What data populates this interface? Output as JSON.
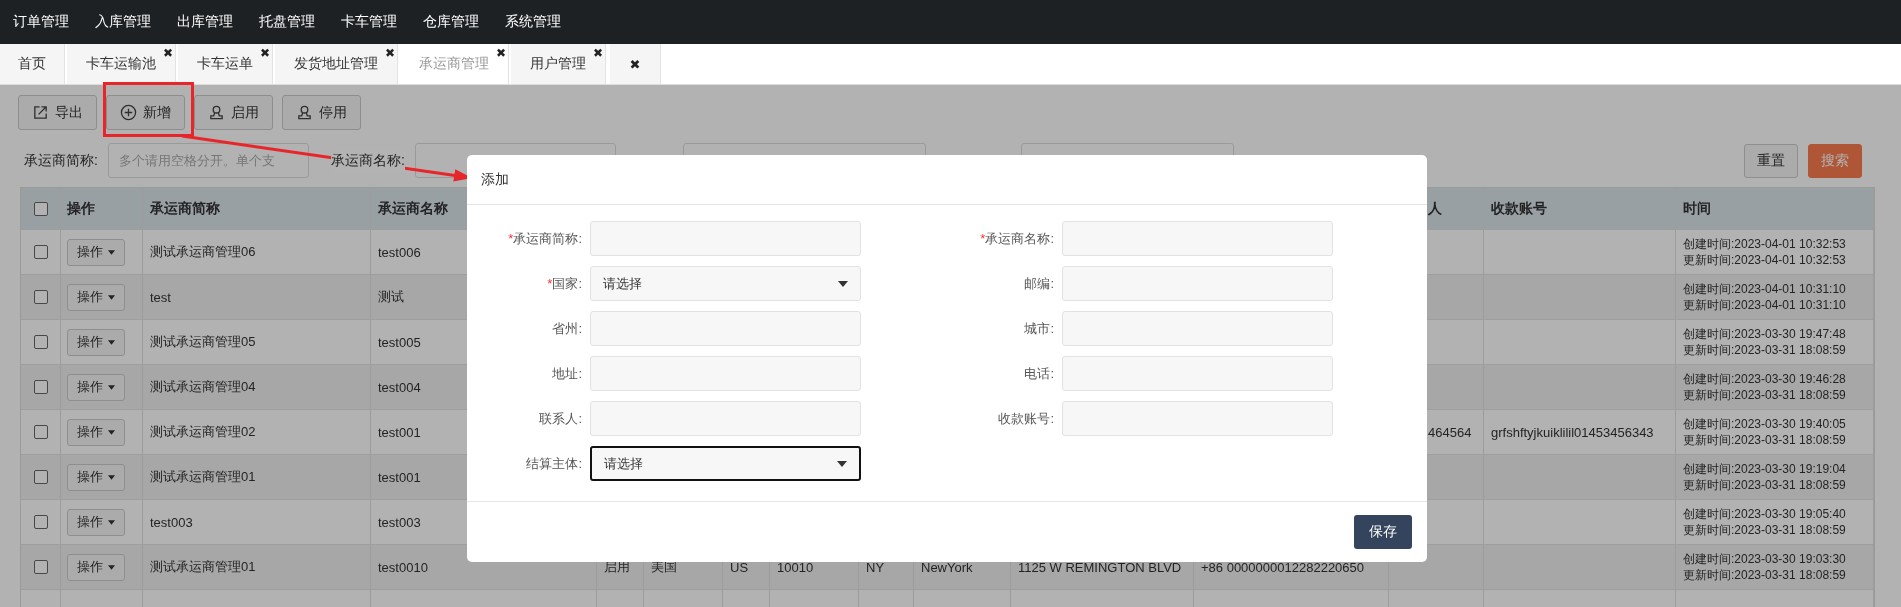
{
  "nav": [
    "订单管理",
    "入库管理",
    "出库管理",
    "托盘管理",
    "卡车管理",
    "仓库管理",
    "系统管理"
  ],
  "tabs": [
    {
      "label": "首页",
      "selected": false
    },
    {
      "label": "卡车运输池",
      "selected": false,
      "close": "✖"
    },
    {
      "label": "卡车运单",
      "selected": false,
      "close": "✖"
    },
    {
      "label": "发货地址管理",
      "selected": false,
      "close": "✖"
    },
    {
      "label": "承运商管理",
      "selected": true,
      "close": "✖"
    },
    {
      "label": "用户管理",
      "selected": false,
      "close": "✖"
    }
  ],
  "close_all": "✖",
  "toolbar": [
    {
      "label": "导出",
      "kind": "export"
    },
    {
      "label": "新增",
      "kind": "add"
    },
    {
      "label": "启用",
      "kind": "user"
    },
    {
      "label": "停用",
      "kind": "user"
    }
  ],
  "filters": [
    {
      "label": "承运商简称:",
      "kind": "text",
      "placeholder": "多个请用空格分开。单个支"
    },
    {
      "label": "承运商名称:",
      "kind": "text"
    },
    {
      "kind": "select"
    },
    {
      "kind": "select"
    }
  ],
  "filter_buttons": [
    {
      "label": "重置",
      "kind": "plain"
    },
    {
      "label": "搜索",
      "kind": "primary"
    }
  ],
  "table": {
    "header_checked": false,
    "columns": [
      "操作",
      "承运商简称",
      "承运商名称",
      "",
      "",
      "",
      "",
      "",
      "",
      "",
      "",
      "人",
      "收款账号",
      "时间"
    ],
    "rows": [
      {
        "checked": false,
        "action": "操作",
        "abbr": "测试承运商管理06",
        "name": "test006",
        "created": "创建时间:2023-04-01 10:32:53",
        "updated": "更新时间:2023-04-01 10:32:53"
      },
      {
        "checked": false,
        "action": "操作",
        "abbr": "test",
        "name": "测试",
        "created": "创建时间:2023-04-01 10:31:10",
        "updated": "更新时间:2023-04-01 10:31:10"
      },
      {
        "checked": false,
        "action": "操作",
        "abbr": "测试承运商管理05",
        "name": "test005",
        "created": "创建时间:2023-03-30 19:47:48",
        "updated": "更新时间:2023-03-31 18:08:59"
      },
      {
        "checked": false,
        "action": "操作",
        "abbr": "测试承运商管理04",
        "name": "test004",
        "created": "创建时间:2023-03-30 19:46:28",
        "updated": "更新时间:2023-03-31 18:08:59"
      },
      {
        "checked": false,
        "action": "操作",
        "abbr": "测试承运商管理02",
        "name": "test001",
        "contact": "464564",
        "account": "grfshftyjkuiklilil01453456343",
        "created": "创建时间:2023-03-30 19:40:05",
        "updated": "更新时间:2023-03-31 18:08:59"
      },
      {
        "checked": false,
        "action": "操作",
        "abbr": "测试承运商管理01",
        "name": "test001",
        "created": "创建时间:2023-03-30 19:19:04",
        "updated": "更新时间:2023-03-31 18:08:59"
      },
      {
        "checked": false,
        "action": "操作",
        "abbr": "test003",
        "name": "test003",
        "created": "创建时间:2023-03-30 19:05:40",
        "updated": "更新时间:2023-03-31 18:08:59"
      },
      {
        "checked": false,
        "action": "操作",
        "abbr": "测试承运商管理01",
        "name": "test0010",
        "status": "启用",
        "country": "美国",
        "code": "US",
        "postal": "10010",
        "state": "NY",
        "city": "NewYork",
        "address": "1125 W REMINGTON BLVD",
        "phone": "+86 0000000012282220650",
        "created": "创建时间:2023-03-30 19:03:30",
        "updated": "更新时间:2023-03-31 18:08:59"
      }
    ]
  },
  "modal": {
    "title": "添加",
    "fields": [
      {
        "label": "承运商简称:",
        "kind": "text",
        "required": true,
        "focused": false
      },
      {
        "label": "承运商名称:",
        "kind": "text",
        "required": true,
        "focused": false
      },
      {
        "label": "国家:",
        "kind": "select",
        "required": true,
        "focused": false,
        "value": "请选择"
      },
      {
        "label": "邮编:",
        "kind": "text",
        "required": false,
        "focused": false
      },
      {
        "label": "省州:",
        "kind": "text",
        "required": false,
        "focused": false
      },
      {
        "label": "城市:",
        "kind": "text",
        "required": false,
        "focused": false
      },
      {
        "label": "地址:",
        "kind": "text",
        "required": false,
        "focused": false
      },
      {
        "label": "电话:",
        "kind": "text",
        "required": false,
        "focused": false
      },
      {
        "label": "联系人:",
        "kind": "text",
        "required": false,
        "focused": false
      },
      {
        "label": "收款账号:",
        "kind": "text",
        "required": false,
        "focused": false
      },
      {
        "label": "结算主体:",
        "kind": "select",
        "required": false,
        "focused": true,
        "value": "请选择"
      }
    ],
    "save": "保存",
    "required_mark": "*"
  }
}
